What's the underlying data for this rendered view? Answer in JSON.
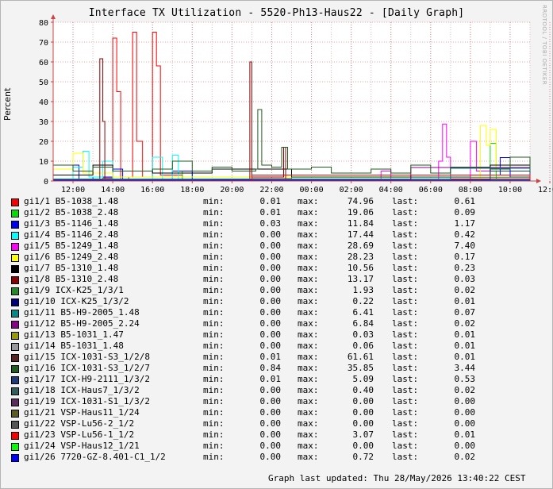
{
  "title": "Interface TX Utilization - 5520-Ph13-Haus22 - [Daily Graph]",
  "watermark": "RRDTOOL / TOBI OETIKER",
  "y_label": "Percent",
  "footer": "Graph last updated: Thu 28/May/2026 13:40:22 CEST",
  "legend_labels": {
    "min": "min:",
    "max": "max:",
    "last": "last:"
  },
  "chart_data": {
    "type": "line",
    "title": "Interface TX Utilization - 5520-Ph13-Haus22 - [Daily Graph]",
    "ylabel": "Percent",
    "xlabel": "",
    "ylim": [
      0,
      80
    ],
    "yticks": [
      "0",
      "10",
      "20",
      "30",
      "40",
      "50",
      "60",
      "70",
      "80"
    ],
    "xticks": [
      "12:00",
      "14:00",
      "16:00",
      "18:00",
      "20:00",
      "22:00",
      "00:00",
      "02:00",
      "04:00",
      "06:00",
      "08:00",
      "10:00",
      "12:00"
    ],
    "grid": true,
    "legend_position": "below",
    "series": [
      {
        "name": "gi1/1 B5-1038_1.48",
        "color": "#ff0000",
        "min": "0.01",
        "max": "74.96",
        "last": "0.61",
        "points": [
          [
            0,
            0.5
          ],
          [
            1.5,
            0.6
          ],
          [
            2.5,
            1.5
          ],
          [
            3.0,
            72
          ],
          [
            3.2,
            45
          ],
          [
            3.4,
            1
          ],
          [
            3.8,
            2
          ],
          [
            4.0,
            75
          ],
          [
            4.2,
            20
          ],
          [
            4.5,
            2
          ],
          [
            5.0,
            75
          ],
          [
            5.2,
            58
          ],
          [
            5.4,
            3
          ],
          [
            6.5,
            1
          ],
          [
            8,
            0.8
          ],
          [
            10,
            1.2
          ],
          [
            12,
            0.5
          ],
          [
            14,
            0.7
          ],
          [
            16,
            0.6
          ],
          [
            18,
            0.9
          ],
          [
            20,
            0.5
          ],
          [
            22,
            0.8
          ],
          [
            24,
            0.6
          ]
        ]
      },
      {
        "name": "gi1/2 B5-1038_2.48",
        "color": "#00e000",
        "min": "0.01",
        "max": "19.06",
        "last": "0.09",
        "points": [
          [
            0,
            0.2
          ],
          [
            6,
            0.3
          ],
          [
            6.5,
            5
          ],
          [
            7,
            0.3
          ],
          [
            12,
            0.2
          ],
          [
            22,
            19
          ],
          [
            22.3,
            0.2
          ],
          [
            24,
            0.1
          ]
        ]
      },
      {
        "name": "gi1/3 B5-1146_1.48",
        "color": "#0000ff",
        "min": "0.03",
        "max": "11.84",
        "last": "1.17",
        "points": [
          [
            0,
            1
          ],
          [
            1,
            8
          ],
          [
            1.3,
            1
          ],
          [
            2,
            2
          ],
          [
            3,
            6
          ],
          [
            3.5,
            1
          ],
          [
            6,
            5
          ],
          [
            7,
            1
          ],
          [
            12,
            1
          ],
          [
            18,
            2
          ],
          [
            21,
            3
          ],
          [
            22.5,
            11.8
          ],
          [
            23,
            2
          ],
          [
            24,
            1.2
          ]
        ]
      },
      {
        "name": "gi1/4 B5-1146_2.48",
        "color": "#00ffff",
        "min": "0.00",
        "max": "17.44",
        "last": "0.42",
        "points": [
          [
            0,
            1
          ],
          [
            1,
            7
          ],
          [
            1.5,
            15
          ],
          [
            1.8,
            2
          ],
          [
            2.5,
            10
          ],
          [
            3,
            1
          ],
          [
            5,
            12
          ],
          [
            5.5,
            1
          ],
          [
            6,
            13
          ],
          [
            6.3,
            1
          ],
          [
            12,
            0.5
          ],
          [
            24,
            0.4
          ]
        ]
      },
      {
        "name": "gi1/5 B5-1249_1.48",
        "color": "#ff00ff",
        "min": "0.00",
        "max": "28.69",
        "last": "7.40",
        "points": [
          [
            0,
            0
          ],
          [
            16,
            0
          ],
          [
            16.5,
            5
          ],
          [
            17,
            0
          ],
          [
            19,
            0
          ],
          [
            19.4,
            10
          ],
          [
            19.6,
            28.7
          ],
          [
            19.8,
            12
          ],
          [
            20,
            1
          ],
          [
            21,
            20
          ],
          [
            21.3,
            5
          ],
          [
            22,
            8
          ],
          [
            24,
            7.4
          ]
        ]
      },
      {
        "name": "gi1/6 B5-1249_2.48",
        "color": "#ffff00",
        "min": "0.00",
        "max": "28.23",
        "last": "0.17",
        "points": [
          [
            0,
            6
          ],
          [
            1,
            14
          ],
          [
            1.5,
            4
          ],
          [
            3,
            2
          ],
          [
            12,
            0.5
          ],
          [
            21.5,
            28
          ],
          [
            21.8,
            18
          ],
          [
            22,
            26
          ],
          [
            22.3,
            5
          ],
          [
            24,
            0.2
          ]
        ]
      },
      {
        "name": "gi1/7 B5-1310_1.48",
        "color": "#000000",
        "min": "0.00",
        "max": "10.56",
        "last": "0.23",
        "points": [
          [
            0,
            3
          ],
          [
            2,
            8
          ],
          [
            3,
            5
          ],
          [
            5,
            4
          ],
          [
            8,
            6
          ],
          [
            12,
            2
          ],
          [
            18,
            3
          ],
          [
            22,
            8
          ],
          [
            24,
            0.2
          ]
        ]
      },
      {
        "name": "gi1/8 B5-1310_2.48",
        "color": "#8b0000",
        "min": "0.00",
        "max": "13.17",
        "last": "0.03",
        "points": [
          [
            0,
            0
          ],
          [
            2.2,
            0
          ],
          [
            2.35,
            61.6
          ],
          [
            2.5,
            30
          ],
          [
            2.6,
            1
          ],
          [
            9.8,
            1
          ],
          [
            9.9,
            60
          ],
          [
            10,
            2
          ],
          [
            11.5,
            2
          ],
          [
            11.6,
            17
          ],
          [
            11.7,
            1
          ],
          [
            24,
            0
          ]
        ]
      },
      {
        "name": "gi1/9 ICX-K25_1/3/1",
        "color": "#228b22",
        "min": "0.00",
        "max": "1.93",
        "last": "0.02",
        "points": [
          [
            0,
            0.5
          ],
          [
            12,
            1.9
          ],
          [
            24,
            0.1
          ]
        ]
      },
      {
        "name": "gi1/10 ICX-K25_1/3/2",
        "color": "#00007f",
        "min": "0.00",
        "max": "0.22",
        "last": "0.01",
        "points": [
          [
            0,
            0.1
          ],
          [
            24,
            0.1
          ]
        ]
      },
      {
        "name": "gi1/11 B5-H9-2005_1.48",
        "color": "#008b8b",
        "min": "0.00",
        "max": "6.41",
        "last": "0.07",
        "points": [
          [
            0,
            1
          ],
          [
            20,
            6.4
          ],
          [
            24,
            0.1
          ]
        ]
      },
      {
        "name": "gi1/12 B5-H9-2005_2.24",
        "color": "#8b008b",
        "min": "0.00",
        "max": "6.84",
        "last": "0.02",
        "points": [
          [
            0,
            0.5
          ],
          [
            18,
            6.8
          ],
          [
            24,
            0.1
          ]
        ]
      },
      {
        "name": "gi1/13 B5-1031_1.47",
        "color": "#999900",
        "min": "0.00",
        "max": "0.03",
        "last": "0.01",
        "points": [
          [
            0,
            0
          ],
          [
            24,
            0
          ]
        ]
      },
      {
        "name": "gi1/14 B5-1031_1.48",
        "color": "#999999",
        "min": "0.00",
        "max": "0.06",
        "last": "0.01",
        "points": [
          [
            0,
            0
          ],
          [
            24,
            0
          ]
        ]
      },
      {
        "name": "gi1/15 ICX-1031-S3_1/2/8",
        "color": "#5a2323",
        "min": "0.01",
        "max": "61.61",
        "last": "0.01",
        "points": [
          [
            0,
            0.2
          ],
          [
            24,
            0.1
          ]
        ]
      },
      {
        "name": "gi1/16 ICX-1031-S3_1/2/7",
        "color": "#1f5c1f",
        "min": "0.84",
        "max": "35.85",
        "last": "3.44",
        "points": [
          [
            0,
            8
          ],
          [
            1,
            5
          ],
          [
            2,
            7
          ],
          [
            3,
            5
          ],
          [
            5,
            6
          ],
          [
            6,
            10
          ],
          [
            7,
            5
          ],
          [
            8,
            7
          ],
          [
            9,
            5
          ],
          [
            10.2,
            6
          ],
          [
            10.3,
            36
          ],
          [
            10.5,
            8
          ],
          [
            11,
            7
          ],
          [
            11.5,
            17
          ],
          [
            11.8,
            6
          ],
          [
            13,
            7
          ],
          [
            14,
            4
          ],
          [
            16,
            6
          ],
          [
            17,
            4
          ],
          [
            18,
            8
          ],
          [
            19,
            4
          ],
          [
            20,
            7
          ],
          [
            22,
            6
          ],
          [
            23,
            12
          ],
          [
            24,
            3.4
          ]
        ]
      },
      {
        "name": "gi1/17 ICX-H9-2111_1/3/2",
        "color": "#1f3a7a",
        "min": "0.01",
        "max": "5.09",
        "last": "0.53",
        "points": [
          [
            0,
            0.5
          ],
          [
            22,
            5
          ],
          [
            24,
            0.5
          ]
        ]
      },
      {
        "name": "gi1/18 ICX-Haus7_1/3/2",
        "color": "#2f5f5f",
        "min": "0.00",
        "max": "0.40",
        "last": "0.02",
        "points": [
          [
            0,
            0.1
          ],
          [
            24,
            0
          ]
        ]
      },
      {
        "name": "gi1/19 ICX-1031-S1_1/3/2",
        "color": "#5c2a5c",
        "min": "0.00",
        "max": "0.00",
        "last": "0.00",
        "points": [
          [
            0,
            0
          ],
          [
            24,
            0
          ]
        ]
      },
      {
        "name": "gi1/21 VSP-Haus11_1/24",
        "color": "#5c5c1f",
        "min": "0.00",
        "max": "0.00",
        "last": "0.00",
        "points": [
          [
            0,
            0
          ],
          [
            24,
            0
          ]
        ]
      },
      {
        "name": "gi1/22 VSP-Lu56-2_1/2",
        "color": "#555555",
        "min": "0.00",
        "max": "0.00",
        "last": "0.00",
        "points": [
          [
            0,
            0
          ],
          [
            24,
            0
          ]
        ]
      },
      {
        "name": "gi1/23 VSP-Lu56-1_1/2",
        "color": "#ff0000",
        "min": "0.00",
        "max": "3.07",
        "last": "0.01",
        "points": [
          [
            0,
            0
          ],
          [
            10,
            3
          ],
          [
            24,
            0
          ]
        ]
      },
      {
        "name": "gi1/24 VSP-Haus12_1/21",
        "color": "#00ff00",
        "min": "0.00",
        "max": "0.00",
        "last": "0.00",
        "points": [
          [
            0,
            0
          ],
          [
            24,
            0
          ]
        ]
      },
      {
        "name": "gi1/26 7720-GZ-8.401-C1_1/2",
        "color": "#0000ff",
        "min": "0.00",
        "max": "0.72",
        "last": "0.02",
        "points": [
          [
            0,
            0.3
          ],
          [
            24,
            0.1
          ]
        ]
      }
    ]
  }
}
